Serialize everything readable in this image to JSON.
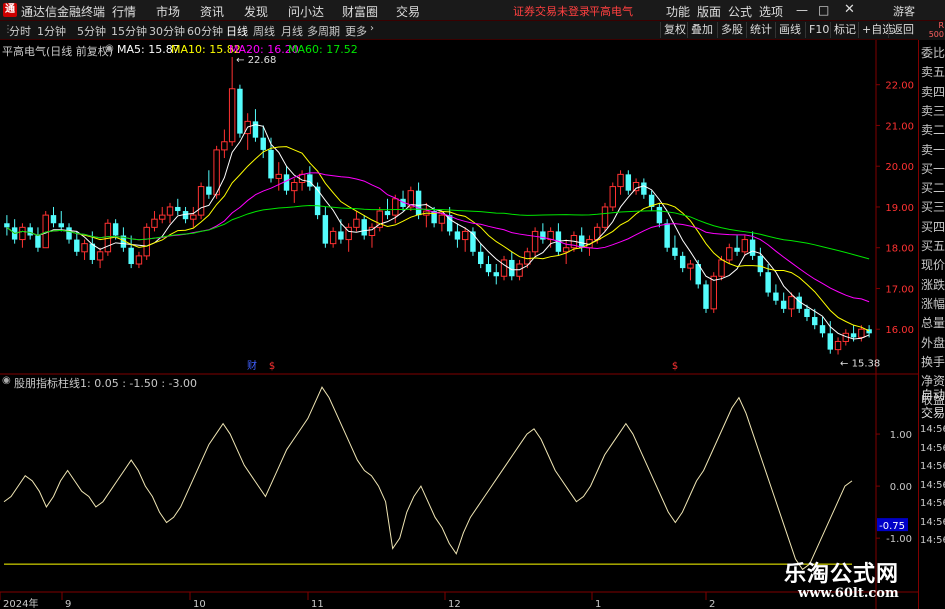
{
  "titlebar": {
    "app_title": "通达信金融终端",
    "menus": [
      "行情",
      "市场",
      "资讯",
      "发现",
      "问小达",
      "财富圈",
      "交易"
    ],
    "notice": "证券交易未登录",
    "stock": "平高电气",
    "right_menus": [
      "功能",
      "版面",
      "公式",
      "选项"
    ],
    "guest": "游客"
  },
  "toolbar": {
    "periods": [
      "分时",
      "1分钟",
      "5分钟",
      "15分钟",
      "30分钟",
      "60分钟",
      "日线",
      "周线",
      "月线",
      "多周期",
      "更多"
    ],
    "active_period": "日线",
    "right_buttons": [
      "复权",
      "叠加",
      "多股",
      "统计",
      "画线",
      "F10",
      "标记",
      "+自选",
      "返回"
    ],
    "corner_top": "R",
    "corner_bottom": "500"
  },
  "main_header": {
    "title": "平高电气(日线 前复权)",
    "ma5": "MA5: 15.87",
    "ma10": "MA10: 15.82",
    "ma20": "MA20: 16.20",
    "ma60": "MA60: 17.52"
  },
  "price_axis": [
    "22.00",
    "21.00",
    "20.00",
    "19.00",
    "18.00",
    "17.00",
    "16.00"
  ],
  "annotations": {
    "high": "22.68",
    "low": "15.38",
    "fin_mark": "财",
    "dollar_mark": "$"
  },
  "indicator_header": {
    "name": "股朋指标",
    "values": "柱线1: 0.05 : -1.50 : -3.00"
  },
  "indicator_axis": [
    "1.00",
    "0.00",
    "-1.00"
  ],
  "indicator_current": "-0.75",
  "date_axis": [
    "2024年",
    "9",
    "10",
    "11",
    "12",
    "1",
    "2"
  ],
  "side_panel": [
    "委比",
    "卖五",
    "卖四",
    "卖三",
    "卖二",
    "卖一",
    "买一",
    "买二",
    "买三",
    "买四",
    "买五",
    "现价",
    "涨跌",
    "涨幅",
    "总量",
    "外盘",
    "换手",
    "净资",
    "收益",
    "自动",
    "交易",
    "14:56",
    "14:56",
    "14:56",
    "14:56",
    "14:56",
    "14:56",
    "14:56"
  ],
  "watermark": {
    "cn": "乐淘公式网",
    "url": "www.60lt.com"
  },
  "colors": {
    "up": "#ff3232",
    "down": "#54fcfc",
    "ma5": "#ffffff",
    "ma10": "#ffff00",
    "ma20": "#ff00ff",
    "ma60": "#00e600",
    "axis_red": "#800000"
  },
  "chart_data": {
    "type": "line",
    "price_ylim": [
      15.0,
      22.9
    ],
    "price_ticks": [
      16,
      17,
      18,
      19,
      20,
      21,
      22
    ],
    "candles": [
      [
        18.6,
        18.8,
        18.3,
        18.5
      ],
      [
        18.5,
        18.7,
        18.1,
        18.2
      ],
      [
        18.2,
        18.6,
        18.0,
        18.5
      ],
      [
        18.5,
        18.6,
        18.2,
        18.3
      ],
      [
        18.3,
        18.5,
        17.9,
        18.0
      ],
      [
        18.0,
        18.9,
        18.0,
        18.8
      ],
      [
        18.8,
        19.0,
        18.5,
        18.6
      ],
      [
        18.6,
        18.9,
        18.4,
        18.5
      ],
      [
        18.5,
        18.6,
        18.1,
        18.2
      ],
      [
        18.2,
        18.4,
        17.8,
        17.9
      ],
      [
        17.9,
        18.2,
        17.7,
        18.1
      ],
      [
        18.1,
        18.4,
        17.6,
        17.7
      ],
      [
        17.7,
        18.0,
        17.5,
        17.9
      ],
      [
        17.9,
        18.7,
        17.8,
        18.6
      ],
      [
        18.6,
        18.7,
        18.2,
        18.3
      ],
      [
        18.3,
        18.5,
        17.9,
        18.0
      ],
      [
        18.0,
        18.3,
        17.5,
        17.6
      ],
      [
        17.6,
        17.9,
        17.5,
        17.8
      ],
      [
        17.8,
        18.6,
        17.7,
        18.5
      ],
      [
        18.5,
        18.9,
        18.4,
        18.7
      ],
      [
        18.7,
        19.0,
        18.6,
        18.8
      ],
      [
        18.8,
        19.1,
        18.6,
        19.0
      ],
      [
        19.0,
        19.2,
        18.8,
        18.9
      ],
      [
        18.9,
        19.0,
        18.6,
        18.7
      ],
      [
        18.7,
        19.0,
        18.5,
        18.8
      ],
      [
        18.8,
        19.6,
        18.7,
        19.5
      ],
      [
        19.5,
        19.9,
        19.2,
        19.3
      ],
      [
        19.3,
        20.5,
        19.2,
        20.4
      ],
      [
        20.4,
        20.9,
        20.2,
        20.6
      ],
      [
        20.6,
        22.68,
        20.5,
        21.9
      ],
      [
        21.9,
        22.0,
        20.7,
        20.8
      ],
      [
        20.8,
        21.3,
        20.4,
        21.1
      ],
      [
        21.1,
        21.4,
        20.6,
        20.7
      ],
      [
        20.7,
        21.0,
        20.2,
        20.4
      ],
      [
        20.4,
        20.7,
        19.6,
        19.7
      ],
      [
        19.7,
        20.1,
        19.4,
        19.8
      ],
      [
        19.8,
        20.0,
        19.3,
        19.4
      ],
      [
        19.4,
        19.7,
        19.1,
        19.6
      ],
      [
        19.6,
        19.9,
        19.4,
        19.8
      ],
      [
        19.8,
        20.0,
        19.4,
        19.5
      ],
      [
        19.5,
        19.6,
        18.7,
        18.8
      ],
      [
        18.8,
        19.0,
        18.0,
        18.1
      ],
      [
        18.1,
        18.5,
        18.0,
        18.4
      ],
      [
        18.4,
        18.7,
        18.1,
        18.2
      ],
      [
        18.2,
        18.6,
        17.9,
        18.5
      ],
      [
        18.5,
        18.9,
        18.4,
        18.7
      ],
      [
        18.7,
        18.8,
        18.2,
        18.3
      ],
      [
        18.3,
        18.6,
        18.0,
        18.5
      ],
      [
        18.5,
        19.0,
        18.4,
        18.9
      ],
      [
        18.9,
        19.2,
        18.7,
        18.8
      ],
      [
        18.8,
        19.3,
        18.6,
        19.2
      ],
      [
        19.2,
        19.4,
        18.9,
        19.0
      ],
      [
        19.0,
        19.5,
        18.9,
        19.4
      ],
      [
        19.4,
        19.6,
        18.7,
        18.8
      ],
      [
        18.8,
        19.1,
        18.5,
        18.9
      ],
      [
        18.9,
        19.0,
        18.5,
        18.6
      ],
      [
        18.6,
        18.9,
        18.4,
        18.8
      ],
      [
        18.8,
        19.0,
        18.3,
        18.4
      ],
      [
        18.4,
        18.6,
        18.0,
        18.2
      ],
      [
        18.2,
        18.5,
        17.9,
        18.4
      ],
      [
        18.4,
        18.5,
        17.8,
        17.9
      ],
      [
        17.9,
        18.1,
        17.5,
        17.6
      ],
      [
        17.6,
        17.8,
        17.3,
        17.4
      ],
      [
        17.4,
        17.6,
        17.1,
        17.3
      ],
      [
        17.3,
        17.8,
        17.2,
        17.7
      ],
      [
        17.7,
        17.9,
        17.2,
        17.3
      ],
      [
        17.3,
        17.7,
        17.2,
        17.6
      ],
      [
        17.6,
        18.0,
        17.5,
        17.9
      ],
      [
        17.9,
        18.5,
        17.8,
        18.4
      ],
      [
        18.4,
        18.6,
        18.1,
        18.2
      ],
      [
        18.2,
        18.5,
        18.0,
        18.4
      ],
      [
        18.4,
        18.6,
        17.8,
        17.9
      ],
      [
        17.9,
        18.2,
        17.6,
        18.0
      ],
      [
        18.0,
        18.4,
        17.9,
        18.3
      ],
      [
        18.3,
        18.5,
        17.9,
        18.0
      ],
      [
        18.0,
        18.3,
        17.8,
        18.2
      ],
      [
        18.2,
        18.6,
        18.1,
        18.5
      ],
      [
        18.5,
        19.1,
        18.4,
        19.0
      ],
      [
        19.0,
        19.6,
        18.9,
        19.5
      ],
      [
        19.5,
        19.9,
        19.3,
        19.8
      ],
      [
        19.8,
        19.9,
        19.3,
        19.4
      ],
      [
        19.4,
        19.7,
        19.3,
        19.6
      ],
      [
        19.6,
        19.7,
        19.2,
        19.3
      ],
      [
        19.3,
        19.4,
        18.9,
        19.0
      ],
      [
        19.0,
        19.1,
        18.5,
        18.6
      ],
      [
        18.6,
        18.7,
        17.9,
        18.0
      ],
      [
        18.0,
        18.3,
        17.7,
        17.8
      ],
      [
        17.8,
        17.9,
        17.4,
        17.5
      ],
      [
        17.5,
        17.7,
        17.2,
        17.6
      ],
      [
        17.6,
        17.7,
        17.0,
        17.1
      ],
      [
        17.1,
        17.2,
        16.4,
        16.5
      ],
      [
        16.5,
        17.4,
        16.4,
        17.3
      ],
      [
        17.3,
        17.8,
        17.2,
        17.7
      ],
      [
        17.7,
        18.1,
        17.6,
        18.0
      ],
      [
        18.0,
        18.3,
        17.8,
        17.9
      ],
      [
        17.9,
        18.3,
        17.8,
        18.2
      ],
      [
        18.2,
        18.4,
        17.7,
        17.8
      ],
      [
        17.8,
        18.0,
        17.3,
        17.4
      ],
      [
        17.4,
        17.6,
        16.8,
        16.9
      ],
      [
        16.9,
        17.1,
        16.6,
        16.7
      ],
      [
        16.7,
        16.9,
        16.4,
        16.5
      ],
      [
        16.5,
        16.9,
        16.3,
        16.8
      ],
      [
        16.8,
        16.9,
        16.4,
        16.5
      ],
      [
        16.5,
        16.6,
        16.2,
        16.3
      ],
      [
        16.3,
        16.5,
        16.0,
        16.1
      ],
      [
        16.1,
        16.3,
        15.8,
        15.9
      ],
      [
        15.9,
        16.2,
        15.4,
        15.5
      ],
      [
        15.5,
        15.8,
        15.38,
        15.7
      ],
      [
        15.7,
        16.0,
        15.6,
        15.9
      ],
      [
        15.9,
        16.1,
        15.7,
        15.8
      ],
      [
        15.8,
        16.1,
        15.7,
        16.0
      ],
      [
        16.0,
        16.1,
        15.8,
        15.9
      ]
    ],
    "ma_series": [
      {
        "name": "MA5"
      },
      {
        "name": "MA10"
      },
      {
        "name": "MA20"
      },
      {
        "name": "MA60"
      }
    ],
    "indicator": {
      "name": "股朋指标",
      "ylim": [
        -1.9,
        2.0
      ],
      "ref_line": -1.5,
      "values": [
        -0.3,
        -0.2,
        0.0,
        0.2,
        0.1,
        -0.1,
        -0.4,
        -0.2,
        0.1,
        0.3,
        0.1,
        -0.1,
        -0.2,
        -0.4,
        -0.3,
        -0.1,
        0.1,
        0.3,
        0.5,
        0.3,
        0.0,
        -0.2,
        -0.5,
        -0.7,
        -0.6,
        -0.4,
        -0.1,
        0.2,
        0.5,
        0.8,
        1.0,
        1.2,
        1.0,
        0.7,
        0.4,
        0.2,
        0.0,
        -0.2,
        0.1,
        0.4,
        0.7,
        0.9,
        1.1,
        1.3,
        1.6,
        1.9,
        1.7,
        1.4,
        1.1,
        0.8,
        0.5,
        0.3,
        0.2,
        0.0,
        -0.3,
        -1.2,
        -1.0,
        -0.5,
        -0.2,
        0.0,
        -0.3,
        -0.6,
        -0.8,
        -1.1,
        -1.3,
        -0.9,
        -0.6,
        -0.4,
        -0.2,
        0.0,
        0.2,
        0.4,
        0.6,
        0.8,
        1.0,
        1.1,
        0.9,
        0.6,
        0.3,
        0.1,
        -0.1,
        -0.3,
        -0.2,
        0.0,
        0.3,
        0.6,
        0.8,
        1.0,
        1.2,
        1.0,
        0.7,
        0.4,
        0.1,
        -0.2,
        -0.5,
        -0.7,
        -0.5,
        -0.2,
        0.1,
        0.3,
        0.6,
        0.9,
        1.2,
        1.5,
        1.7,
        1.4,
        1.0,
        0.6,
        0.2,
        -0.2,
        -0.6,
        -1.0,
        -1.4,
        -1.6,
        -1.5,
        -1.2,
        -0.9,
        -0.6,
        -0.3,
        0.0,
        0.1
      ]
    }
  }
}
